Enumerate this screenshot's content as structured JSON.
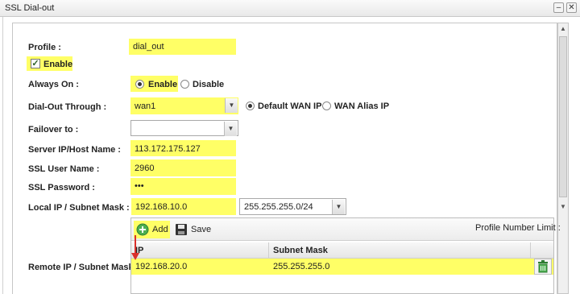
{
  "window": {
    "title": "SSL Dial-out",
    "min_glyph": "–",
    "close_glyph": "✕"
  },
  "form": {
    "profile": {
      "label": "Profile :",
      "value": "dial_out"
    },
    "enable": {
      "label": "Enable",
      "checked": true
    },
    "always_on": {
      "label": "Always On :",
      "options": [
        "Enable",
        "Disable"
      ],
      "selected": "Enable"
    },
    "dial_out_through": {
      "label": "Dial-Out Through :",
      "value": "wan1",
      "options": [
        "Default WAN IP",
        "WAN Alias IP"
      ],
      "selected": "Default WAN IP"
    },
    "failover": {
      "label": "Failover to :",
      "value": ""
    },
    "server": {
      "label": "Server IP/Host Name :",
      "value": "113.172.175.127"
    },
    "ssl_user": {
      "label": "SSL User Name :",
      "value": "2960"
    },
    "ssl_password": {
      "label": "SSL Password :",
      "value": "•••"
    },
    "local_ip": {
      "label": "Local IP / Subnet Mask :",
      "ip": "192.168.10.0",
      "mask": "255.255.255.0/24"
    },
    "remote_ip": {
      "label": "Remote IP / Subnet Mask :",
      "toolbar": {
        "add_label": "Add",
        "save_label": "Save",
        "limit_label": "Profile Number Limit :"
      },
      "columns": [
        "IP",
        "Subnet Mask"
      ],
      "rows": [
        {
          "ip": "192.168.20.0",
          "mask": "255.255.255.0"
        }
      ]
    }
  },
  "colors": {
    "highlight": "#ffff66",
    "annotation_arrow": "#d9302b"
  },
  "icons": [
    "check-icon",
    "dropdown-arrow-icon",
    "add-icon",
    "save-icon",
    "trash-icon",
    "scroll-up-icon",
    "scroll-down-icon"
  ]
}
